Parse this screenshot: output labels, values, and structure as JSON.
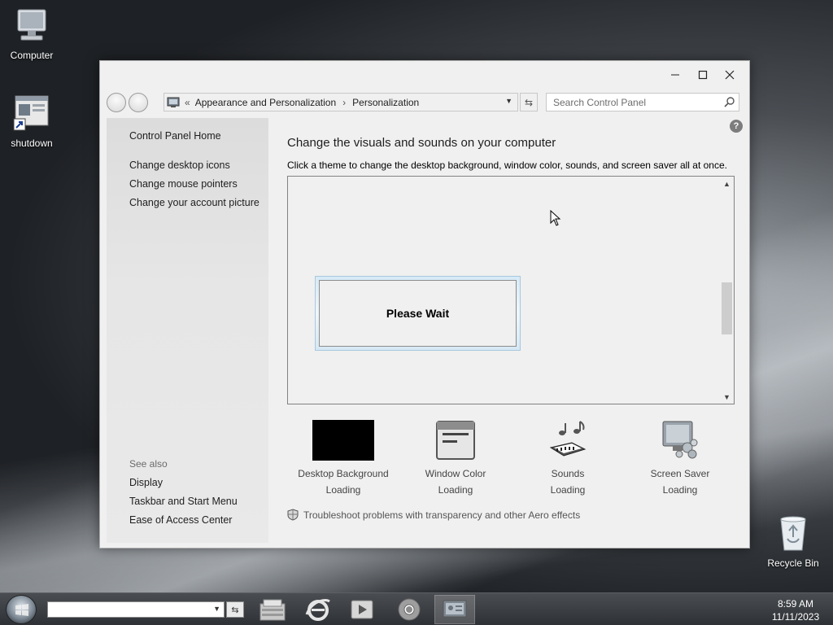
{
  "desktop": {
    "icons": [
      {
        "label": "Computer",
        "icon": "computer-icon"
      },
      {
        "label": "shutdown",
        "icon": "shortcut-icon"
      },
      {
        "label": "Recycle Bin",
        "icon": "recycle-bin-icon"
      }
    ]
  },
  "window": {
    "controls": {
      "minimize": "—",
      "maximize": "☐",
      "close": "✕"
    },
    "address": {
      "chevron": "«",
      "crumbs": [
        "Appearance and Personalization",
        "Personalization"
      ],
      "separator": "›"
    },
    "search_placeholder": "Search Control Panel",
    "help": "?",
    "sidebar": {
      "home": "Control Panel Home",
      "links": [
        "Change desktop icons",
        "Change mouse pointers",
        "Change your account picture"
      ],
      "see_also_label": "See also",
      "see_also": [
        "Display",
        "Taskbar and Start Menu",
        "Ease of Access Center"
      ]
    },
    "main": {
      "heading": "Change the visuals and sounds on your computer",
      "subheading": "Click a theme to change the desktop background, window color, sounds, and screen saver all at once.",
      "wait_text": "Please Wait",
      "tiles": [
        {
          "label": "Desktop Background",
          "status": "Loading",
          "icon": "desktop-background-icon"
        },
        {
          "label": "Window Color",
          "status": "Loading",
          "icon": "window-color-icon"
        },
        {
          "label": "Sounds",
          "status": "Loading",
          "icon": "sounds-icon"
        },
        {
          "label": "Screen Saver",
          "status": "Loading",
          "icon": "screen-saver-icon"
        }
      ],
      "troubleshoot": "Troubleshoot problems with transparency and other Aero effects"
    }
  },
  "taskbar": {
    "apps": [
      "file-explorer-icon",
      "internet-explorer-icon",
      "media-player-icon",
      "chrome-icon",
      "control-panel-icon"
    ],
    "active_app": "control-panel-icon",
    "time": "8:59 AM",
    "date": "11/11/2023"
  },
  "colors": {
    "window_bg": "#f0f0f0",
    "sidebar_bg": "#e3e3e3",
    "taskbar": "#2e3135",
    "wait_border": "#a9c8de"
  }
}
